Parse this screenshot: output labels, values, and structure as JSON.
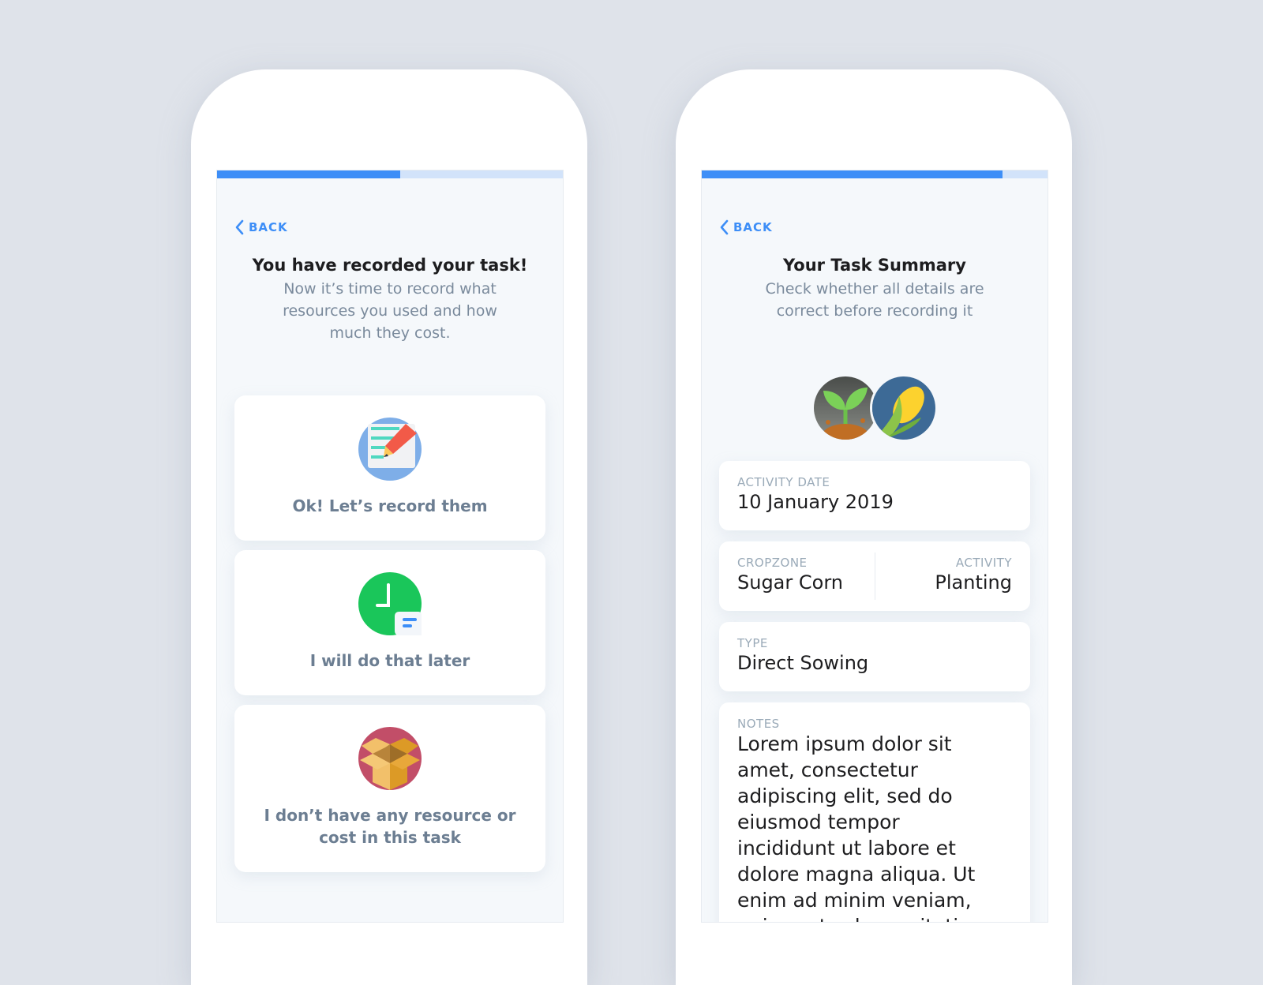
{
  "left_screen": {
    "progress_percent": 53,
    "back_label": "BACK",
    "title": "You have recorded your task!",
    "subtitle": "Now it’s time to record what resources you used and how much they cost.",
    "options": [
      {
        "icon": "edit-document-icon",
        "label": "Ok! Let’s record them"
      },
      {
        "icon": "clock-icon",
        "label": "I will do that later"
      },
      {
        "icon": "open-box-icon",
        "label": "I don’t have any resource or cost in this task"
      }
    ]
  },
  "right_screen": {
    "progress_percent": 87,
    "back_label": "BACK",
    "title": "Your Task Summary",
    "subtitle": "Check whether all details are correct before recording it",
    "avatars": [
      "sprout-icon",
      "corn-icon"
    ],
    "activity_date": {
      "label": "ACTIVITY DATE",
      "value": "10 January 2019"
    },
    "cropzone": {
      "label": "CROPZONE",
      "value": "Sugar Corn"
    },
    "activity": {
      "label": "ACTIVITY",
      "value": "Planting"
    },
    "type": {
      "label": "TYPE",
      "value": "Direct Sowing"
    },
    "notes": {
      "label": "NOTES",
      "value": "Lorem ipsum dolor sit amet, consectetur adipiscing elit, sed do eiusmod tempor incididunt ut labore et dolore magna aliqua. Ut enim ad minim veniam, quis nostrud exercitation"
    }
  }
}
